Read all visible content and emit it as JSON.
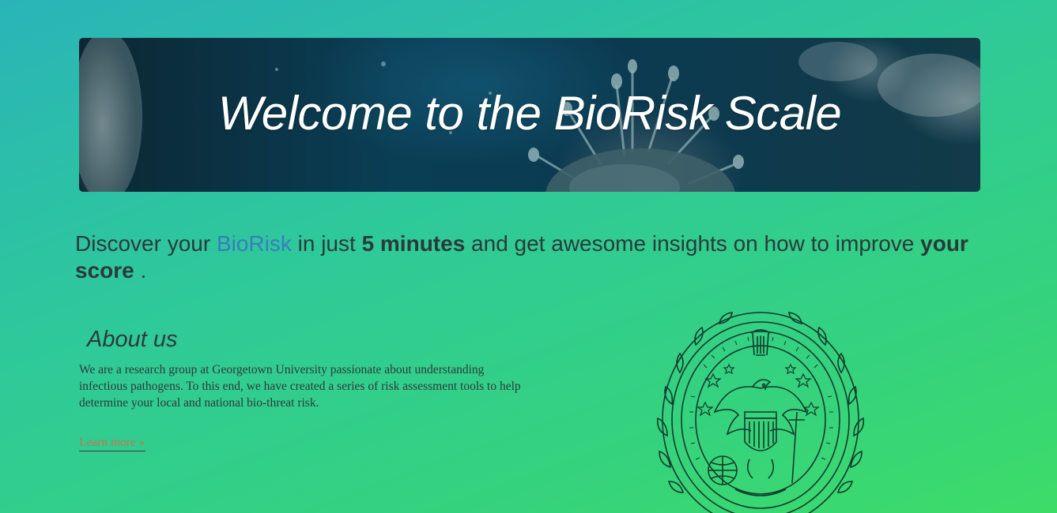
{
  "banner": {
    "title": "Welcome to the BioRisk Scale"
  },
  "tagline": {
    "part1": "Discover your ",
    "brand": "BioRisk",
    "part2": " in just ",
    "bold1": "5 minutes",
    "part3": " and get awesome insights on how to improve ",
    "bold2": "your score",
    "part4": " ."
  },
  "about": {
    "heading": "About us",
    "body": "We are a research group at Georgetown University passionate about understanding infectious pathogens. To this end, we have created a series of risk assessment tools to help determine your local and national bio-threat risk.",
    "link_label": "Learn more »"
  },
  "seal": {
    "icon": "georgetown-seal-icon",
    "ring_text": "UTRAQUE · UNUM · POTOMACI · IN · MARYLANDIA · AD · RIPAS"
  },
  "colors": {
    "brand_link": "#3b7bbf",
    "learn_more": "#c0784e",
    "background_start": "#2ab4b8",
    "background_end": "#3ddc68"
  }
}
